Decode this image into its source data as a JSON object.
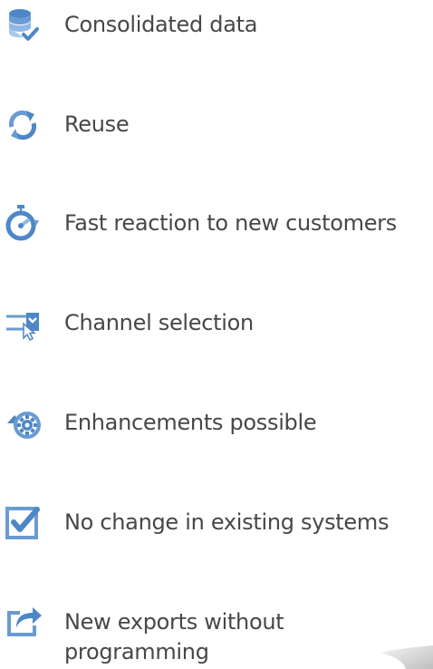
{
  "benefits": [
    {
      "label": "Consolidated data",
      "icon": "database-check-icon"
    },
    {
      "label": "Reuse",
      "icon": "refresh-cycle-icon"
    },
    {
      "label": "Fast reaction to new customers",
      "icon": "stopwatch-icon"
    },
    {
      "label": "Channel selection",
      "icon": "channel-pointer-icon"
    },
    {
      "label": "Enhancements possible",
      "icon": "gear-upgrade-icon"
    },
    {
      "label": "No change in existing systems",
      "icon": "checkbox-checked-icon"
    },
    {
      "label": "New exports without programming",
      "icon": "share-export-icon"
    }
  ],
  "colors": {
    "icon_primary": "#4d87c7",
    "icon_light": "#8fb8e6",
    "text": "#474747"
  }
}
